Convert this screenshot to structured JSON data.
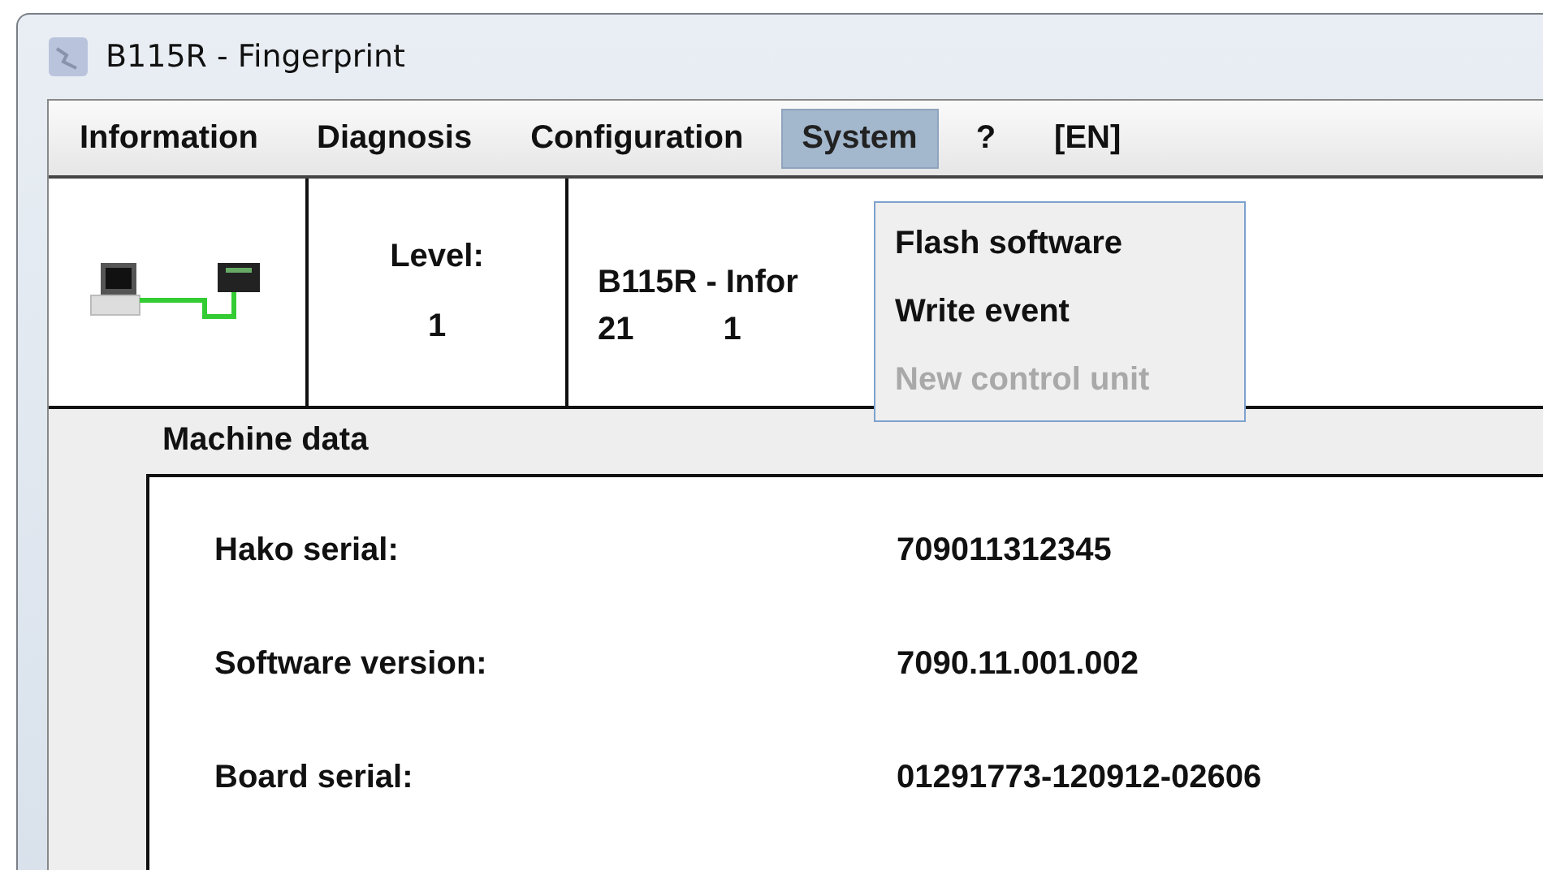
{
  "window": {
    "title": "B115R - Fingerprint"
  },
  "menubar": [
    {
      "label": "Information",
      "selected": false
    },
    {
      "label": "Diagnosis",
      "selected": false
    },
    {
      "label": "Configuration",
      "selected": false
    },
    {
      "label": "System",
      "selected": true
    },
    {
      "label": "?",
      "selected": false
    },
    {
      "label": "[EN]",
      "selected": false
    }
  ],
  "system_menu": [
    {
      "label": "Flash software",
      "disabled": false
    },
    {
      "label": "Write event",
      "disabled": false
    },
    {
      "label": "New control unit",
      "disabled": true
    }
  ],
  "status_row": {
    "level_label": "Level:",
    "level_value": "1",
    "info_title": "B115R - Infor",
    "info_values": [
      "21",
      "1"
    ]
  },
  "machine_data": {
    "title": "Machine data",
    "rows": [
      {
        "label": "Hako serial:",
        "value": "709011312345"
      },
      {
        "label": "Software version:",
        "value": "7090.11.001.002"
      },
      {
        "label": "Board serial:",
        "value": "01291773-120912-02606"
      }
    ]
  }
}
